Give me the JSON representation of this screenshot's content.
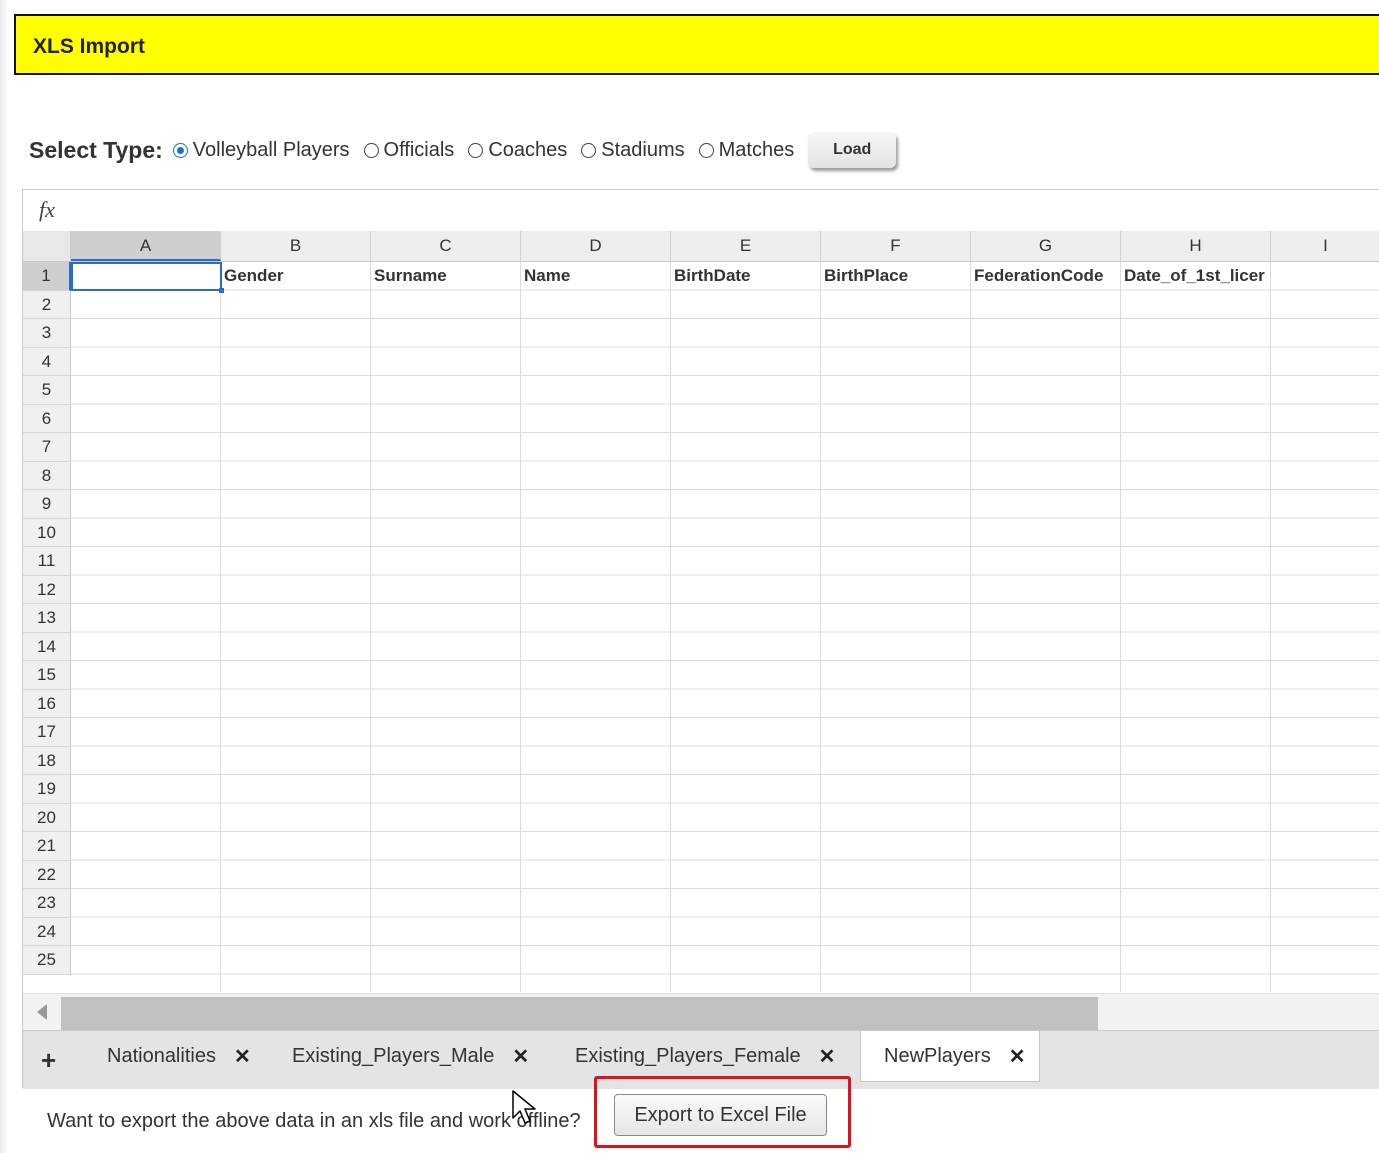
{
  "header": {
    "title": "XLS Import"
  },
  "type_selector": {
    "label": "Select Type:",
    "options": [
      {
        "label": "Volleyball Players",
        "checked": true
      },
      {
        "label": "Officials",
        "checked": false
      },
      {
        "label": "Coaches",
        "checked": false
      },
      {
        "label": "Stadiums",
        "checked": false
      },
      {
        "label": "Matches",
        "checked": false
      }
    ],
    "load_label": "Load"
  },
  "spreadsheet": {
    "formula_icon": "fx",
    "columns": [
      "A",
      "B",
      "C",
      "D",
      "E",
      "F",
      "G",
      "H",
      "I"
    ],
    "rows": [
      "1",
      "2",
      "3",
      "4",
      "5",
      "6",
      "7",
      "8",
      "9",
      "10",
      "11",
      "12",
      "13",
      "14",
      "15",
      "16",
      "17",
      "18",
      "19",
      "20",
      "21",
      "22",
      "23",
      "24",
      "25"
    ],
    "row1": [
      "",
      "Gender",
      "Surname",
      "Name",
      "BirthDate",
      "BirthPlace",
      "FederationCode",
      "Date_of_1st_licer",
      ""
    ],
    "active_cell": "A1"
  },
  "tabs": {
    "add_label": "+",
    "items": [
      {
        "label": "Nationalities",
        "active": false
      },
      {
        "label": "Existing_Players_Male",
        "active": false
      },
      {
        "label": "Existing_Players_Female",
        "active": false
      },
      {
        "label": "NewPlayers",
        "active": true
      }
    ],
    "close_glyph": "✕"
  },
  "export": {
    "prompt": "Want to export the above data in an xls file and work offline?",
    "button_label": "Export to Excel File"
  },
  "colors": {
    "header_bg": "#ffff00",
    "highlight": "#e0101c",
    "accent": "#2a6dc9"
  }
}
